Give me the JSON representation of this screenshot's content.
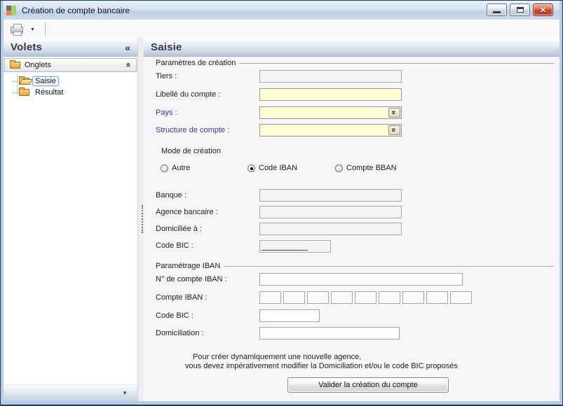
{
  "window": {
    "title": "Création de compte bancaire"
  },
  "icons": {
    "print_dropdown": "▼",
    "panel_collapse": "«",
    "group_collapse": "«",
    "combo_dropdown": "«",
    "footer_dropdown": "▼",
    "close_glyph": "✕"
  },
  "sidebar": {
    "title": "Volets",
    "group_label": "Onglets",
    "items": [
      {
        "label": "Saisie",
        "selected": true
      },
      {
        "label": "Résultat",
        "selected": false
      }
    ]
  },
  "main": {
    "title": "Saisie",
    "group_creation": {
      "title": "Paramètres de création",
      "tiers_label": "Tiers :",
      "tiers_value": "",
      "libelle_label": "Libellé du compte :",
      "libelle_value": "",
      "pays_label": "Pays :",
      "pays_value": "",
      "structure_label": "Structure de compte :",
      "structure_value": ""
    },
    "mode": {
      "label": "Mode de création",
      "options": [
        {
          "label": "Autre",
          "selected": false
        },
        {
          "label": "Code IBAN",
          "selected": true
        },
        {
          "label": "Compte BBAN",
          "selected": false
        }
      ]
    },
    "bank": {
      "banque_label": "Banque :",
      "banque_value": "",
      "agence_label": "Agence bancaire :",
      "agence_value": "",
      "domiciliee_label": "Domiciliée à :",
      "domiciliee_value": "",
      "bic_label": "Code BIC :",
      "bic_value": ""
    },
    "group_iban": {
      "title": "Paramétrage IBAN",
      "numero_label": "N° de compte IBAN :",
      "numero_value": "",
      "compte_label": "Compte IBAN :",
      "compte_segments": 9,
      "bic_label": "Code BIC :",
      "bic_value": "",
      "domiciliation_label": "Domiciliation :",
      "domiciliation_value": ""
    },
    "note_line1": "Pour créer dynamiquement une nouvelle agence,",
    "note_line2": "vous devez impérativement modifier la Domiciliation et/ou le code BIC proposés",
    "submit_label": "Valider la création du compte"
  },
  "colors": {
    "field_yellow": "#ffffd6",
    "blue_label": "#3434a8",
    "close_red": "#cf4228",
    "frame_blue": "#b7cbe1"
  }
}
